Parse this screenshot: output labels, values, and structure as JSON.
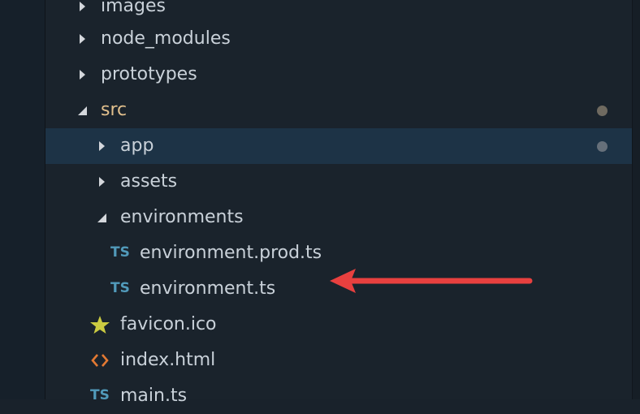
{
  "explorer": {
    "items": [
      {
        "label": "images",
        "type": "folder",
        "state": "collapsed"
      },
      {
        "label": "node_modules",
        "type": "folder",
        "state": "collapsed"
      },
      {
        "label": "prototypes",
        "type": "folder",
        "state": "collapsed"
      },
      {
        "label": "src",
        "type": "folder",
        "state": "expanded",
        "modified": true
      },
      {
        "label": "app",
        "type": "folder",
        "state": "collapsed",
        "selected": true,
        "modified": true
      },
      {
        "label": "assets",
        "type": "folder",
        "state": "collapsed"
      },
      {
        "label": "environments",
        "type": "folder",
        "state": "expanded"
      },
      {
        "label": "environment.prod.ts",
        "type": "file",
        "icon": "typescript-icon",
        "icon_text": "TS"
      },
      {
        "label": "environment.ts",
        "type": "file",
        "icon": "typescript-icon",
        "icon_text": "TS"
      },
      {
        "label": "favicon.ico",
        "type": "file",
        "icon": "star-icon"
      },
      {
        "label": "index.html",
        "type": "file",
        "icon": "html-icon"
      },
      {
        "label": "main.ts",
        "type": "file",
        "icon": "typescript-icon",
        "icon_text": "TS"
      }
    ]
  },
  "colors": {
    "ts_icon": "#519aba",
    "html_icon": "#e37933",
    "star_icon": "#cbcb41",
    "modified_text": "#e2c08d",
    "arrow": "#e8403f",
    "selection": "#1d3346"
  }
}
